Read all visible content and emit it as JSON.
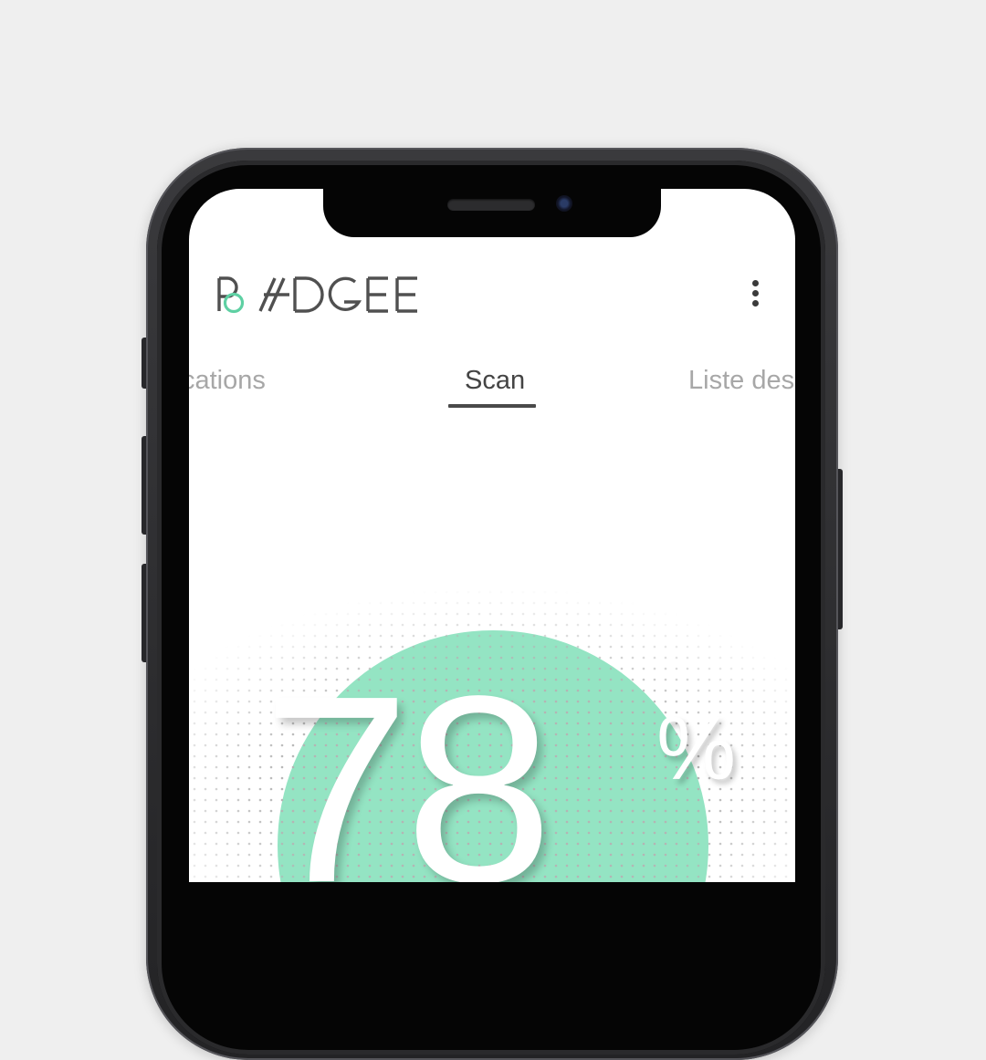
{
  "app": {
    "logo_text": "BADGEE",
    "brand_color": "#5ed0a3",
    "menu_icon": "more-vertical-icon"
  },
  "tabs": [
    {
      "label": "cations",
      "active": false
    },
    {
      "label": "Scan",
      "active": true
    },
    {
      "label": "Liste des",
      "active": false
    }
  ],
  "score": {
    "value": "78",
    "unit": "%",
    "circle_color": "#94e4c3",
    "dot_color": "#b4b4b4"
  }
}
